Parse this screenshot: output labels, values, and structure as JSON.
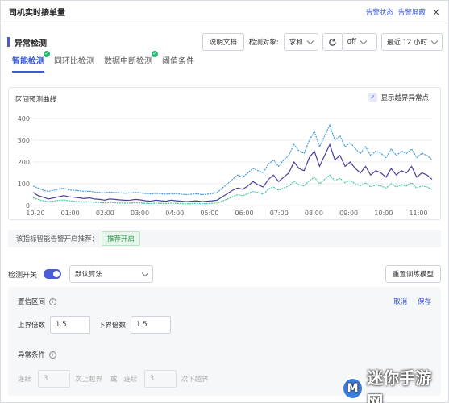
{
  "window": {
    "title": "司机实时接单量",
    "links": [
      "告警状态",
      "告警屏蔽"
    ],
    "close": "×"
  },
  "section": {
    "title": "异常检测",
    "doc_button": "说明文档",
    "target_label": "检测对象:",
    "target_value": "求和",
    "refresh_icon": "refresh-icon",
    "switch_value": "off",
    "range_value": "最近 12 小时"
  },
  "tabs": [
    {
      "label": "智能检测",
      "active": true,
      "ok": true
    },
    {
      "label": "同环比检测",
      "active": false,
      "ok": false
    },
    {
      "label": "数据中断检测",
      "active": false,
      "ok": true
    },
    {
      "label": "阈值条件",
      "active": false,
      "ok": false
    }
  ],
  "chart_panel": {
    "title": "区间预测曲线",
    "show_anomaly_label": "显示越界异常点",
    "show_anomaly_checked": true
  },
  "chart_data": {
    "type": "line",
    "x_ticks": [
      "10-20",
      "01:00",
      "02:00",
      "03:00",
      "04:00",
      "05:00",
      "06:00",
      "07:00",
      "08:00",
      "09:00",
      "10:00",
      "11:00"
    ],
    "y_ticks": [
      0,
      100,
      200,
      300,
      400
    ],
    "ylim": [
      0,
      400
    ],
    "series_colors": {
      "actual": "#4b3f9e",
      "upper": "#3e9be0",
      "lower": "#47c6a4"
    },
    "actual": [
      60,
      45,
      38,
      30,
      35,
      40,
      45,
      40,
      38,
      35,
      32,
      35,
      30,
      28,
      25,
      30,
      28,
      26,
      24,
      25,
      28,
      26,
      22,
      20,
      25,
      22,
      20,
      25,
      22,
      20,
      18,
      20,
      22,
      18,
      20,
      22,
      25,
      40,
      55,
      70,
      80,
      75,
      90,
      110,
      95,
      85,
      120,
      140,
      110,
      130,
      150,
      200,
      170,
      160,
      220,
      250,
      180,
      230,
      280,
      210,
      230,
      180,
      200,
      170,
      150,
      180,
      140,
      160,
      150,
      130,
      170,
      140,
      160,
      150,
      180,
      130,
      150,
      140,
      120
    ],
    "upper": [
      90,
      80,
      70,
      65,
      70,
      75,
      80,
      72,
      70,
      68,
      65,
      66,
      62,
      60,
      58,
      62,
      60,
      58,
      56,
      58,
      60,
      58,
      55,
      53,
      56,
      54,
      52,
      55,
      54,
      52,
      50,
      52,
      54,
      50,
      52,
      55,
      60,
      80,
      100,
      120,
      140,
      130,
      150,
      170,
      160,
      150,
      190,
      210,
      180,
      210,
      230,
      280,
      250,
      240,
      300,
      340,
      270,
      320,
      370,
      300,
      320,
      270,
      290,
      260,
      240,
      270,
      230,
      250,
      240,
      220,
      260,
      230,
      250,
      240,
      260,
      220,
      240,
      230,
      210
    ],
    "lower": [
      35,
      28,
      22,
      18,
      20,
      24,
      26,
      22,
      20,
      18,
      16,
      18,
      15,
      14,
      12,
      14,
      13,
      12,
      11,
      12,
      13,
      12,
      10,
      9,
      11,
      10,
      9,
      11,
      10,
      9,
      8,
      9,
      10,
      8,
      9,
      10,
      12,
      20,
      30,
      40,
      50,
      45,
      55,
      65,
      60,
      52,
      75,
      85,
      70,
      80,
      90,
      110,
      95,
      90,
      115,
      130,
      100,
      120,
      140,
      115,
      125,
      105,
      115,
      100,
      90,
      105,
      85,
      95,
      90,
      80,
      100,
      85,
      95,
      90,
      105,
      80,
      90,
      85,
      75
    ]
  },
  "recommend": {
    "text": "该指标智能告警开启推荐：",
    "pill": "推荐开启"
  },
  "detect": {
    "switch_label": "检测开关",
    "switch_on": true,
    "algo_value": "默认算法",
    "retrain_button": "重置训练模型"
  },
  "confidence": {
    "title": "置信区间",
    "cancel": "取消",
    "save": "保存",
    "upper_label": "上界倍数",
    "upper_value": "1.5",
    "lower_label": "下界倍数",
    "lower_value": "1.5"
  },
  "anomaly": {
    "title": "异常条件",
    "cont1": "连续",
    "val1": "3",
    "above": "次上越界",
    "or": "或",
    "cont2": "连续",
    "val2": "3",
    "below": "次下越界"
  },
  "watermark": {
    "text": "迷你手游网",
    "logo": "M"
  }
}
